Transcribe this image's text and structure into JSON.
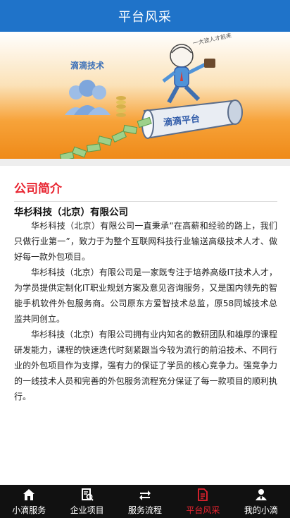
{
  "header": {
    "title": "平台风采"
  },
  "banner": {
    "left_logo_text": "滴滴技术",
    "tube_text": "滴滴平台",
    "speech_text": "一大波人才前来"
  },
  "section": {
    "title": "公司简介",
    "company_name": "华杉科技（北京）有限公司",
    "paragraphs": [
      "华杉科技（北京）有限公司一直秉承“在高薪和经验的路上，我们只做行业第一”，致力于为整个互联网科技行业输送高级技术人才、做好每一款外包项目。",
      "华杉科技（北京）有限公司是一家既专注于培养高级IT技术人才，为学员提供定制化IT职业规划方案及意见咨询服务，又是国内领先的智能手机软件外包服务商。公司原东方爱智技术总监，原58同城技术总监共同创立。",
      "华杉科技（北京）有限公司拥有业内知名的教研团队和雄厚的课程研发能力，课程的快速迭代时刻紧跟当今较为流行的前沿技术、不同行业的外包项目作为支撑，强有力的保证了学员的核心竞争力。强竞争力的一线技术人员和完善的外包服务流程充分保证了每一款项目的顺利执行。"
    ]
  },
  "tabbar": {
    "active_color": "#e8232f",
    "items": [
      {
        "label": "小滴服务",
        "icon": "home-icon"
      },
      {
        "label": "企业项目",
        "icon": "project-icon"
      },
      {
        "label": "服务流程",
        "icon": "process-icon"
      },
      {
        "label": "平台风采",
        "icon": "document-icon"
      },
      {
        "label": "我的小滴",
        "icon": "user-icon"
      }
    ]
  }
}
